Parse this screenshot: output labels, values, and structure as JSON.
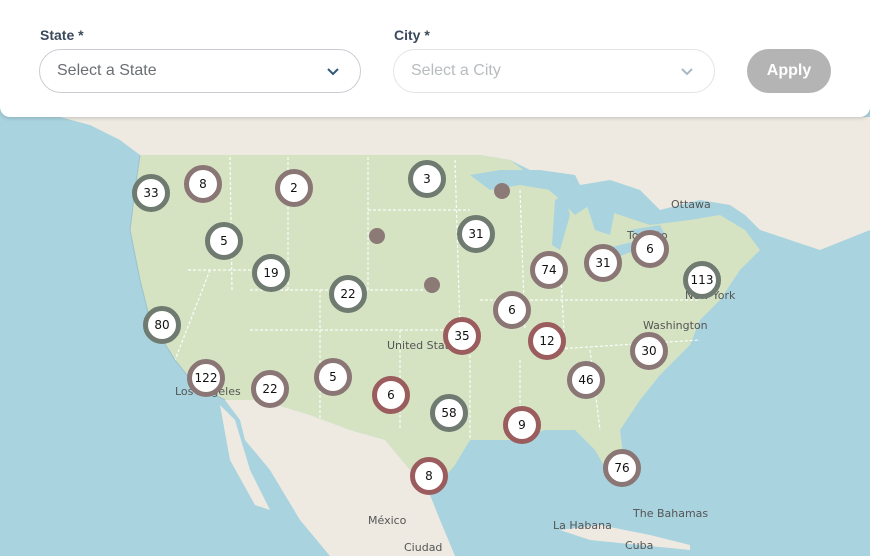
{
  "filters": {
    "state": {
      "label": "State *",
      "placeholder": "Select a State"
    },
    "city": {
      "label": "City *",
      "placeholder": "Select a City"
    },
    "apply_label": "Apply"
  },
  "map": {
    "labels": {
      "ottawa": "Ottawa",
      "toronto": "Toronto",
      "new_york": "New York",
      "washington": "Washington",
      "united_states": "United States",
      "los_angeles": "Los Angeles",
      "mexico": "México",
      "ciudad": "Ciudad",
      "la_habana": "La Habana",
      "bahamas": "The Bahamas",
      "cuba": "Cuba"
    },
    "clusters": [
      {
        "count": "33",
        "style": "gray"
      },
      {
        "count": "8",
        "style": "mixed"
      },
      {
        "count": "2",
        "style": "mixed"
      },
      {
        "count": "3",
        "style": "gray"
      },
      {
        "count": "5",
        "style": "gray"
      },
      {
        "count": "31",
        "style": "gray"
      },
      {
        "count": "19",
        "style": "gray"
      },
      {
        "count": "22",
        "style": "gray"
      },
      {
        "count": "74",
        "style": "mixed"
      },
      {
        "count": "31",
        "style": "mixed"
      },
      {
        "count": "6",
        "style": "mixed"
      },
      {
        "count": "113",
        "style": "gray"
      },
      {
        "count": "80",
        "style": "gray"
      },
      {
        "count": "6",
        "style": "mixed"
      },
      {
        "count": "35",
        "style": "red"
      },
      {
        "count": "12",
        "style": "red"
      },
      {
        "count": "30",
        "style": "mixed"
      },
      {
        "count": "122",
        "style": "mixed"
      },
      {
        "count": "22",
        "style": "mixed"
      },
      {
        "count": "5",
        "style": "mixed"
      },
      {
        "count": "6",
        "style": "red"
      },
      {
        "count": "58",
        "style": "gray"
      },
      {
        "count": "46",
        "style": "mixed"
      },
      {
        "count": "9",
        "style": "red"
      },
      {
        "count": "8",
        "style": "red"
      },
      {
        "count": "76",
        "style": "mixed"
      }
    ]
  },
  "colors": {
    "land": "#d5e3c3",
    "water": "#a9d3df",
    "cluster_gray": "#6f7a70",
    "cluster_mixed": "#8b7676",
    "cluster_red": "#9a5c5c"
  }
}
